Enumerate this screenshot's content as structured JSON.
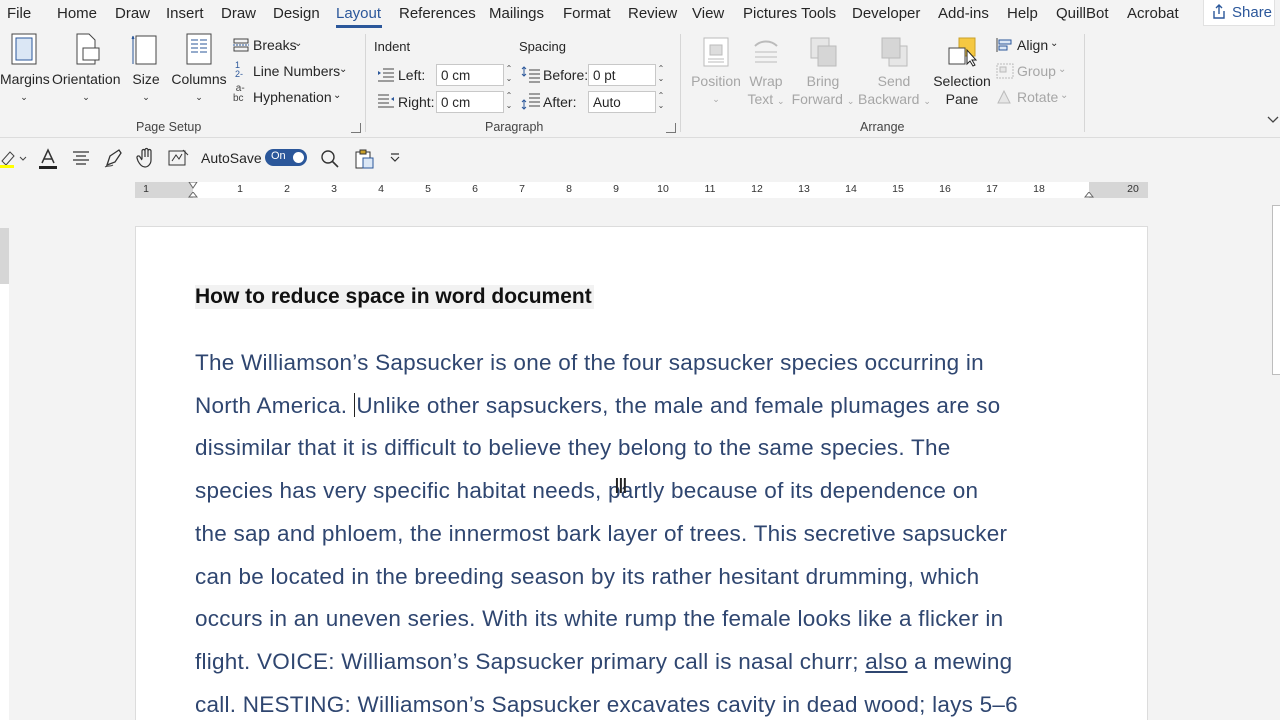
{
  "menu": {
    "tabs": [
      "File",
      "Home",
      "Draw",
      "Insert",
      "Draw",
      "Design",
      "Layout",
      "References",
      "Mailings",
      "Format",
      "Review",
      "View",
      "Pictures Tools",
      "Developer",
      "Add-ins",
      "Help",
      "QuillBot",
      "Acrobat"
    ],
    "active": "Layout",
    "share": "Share"
  },
  "ribbon": {
    "page_setup": {
      "margins": "Margins",
      "orientation": "Orientation",
      "size": "Size",
      "columns": "Columns",
      "breaks": "Breaks",
      "line_numbers": "Line Numbers",
      "hyphenation": "Hyphenation",
      "group_label": "Page Setup"
    },
    "paragraph": {
      "indent_header": "Indent",
      "spacing_header": "Spacing",
      "left_label": "Left:",
      "left_value": "0 cm",
      "right_label": "Right:",
      "right_value": "0 cm",
      "before_label": "Before:",
      "before_value": "0 pt",
      "after_label": "After:",
      "after_value": "Auto",
      "group_label": "Paragraph"
    },
    "arrange": {
      "position": "Position",
      "wrap_1": "Wrap",
      "wrap_2": "Text",
      "bring_1": "Bring",
      "bring_2": "Forward",
      "send_1": "Send",
      "send_2": "Backward",
      "selection_1": "Selection",
      "selection_2": "Pane",
      "align": "Align",
      "group": "Group",
      "rotate": "Rotate",
      "group_label": "Arrange"
    }
  },
  "qat": {
    "autosave_label": "AutoSave",
    "toggle_state": "On"
  },
  "ruler": {
    "numbers": [
      "1",
      "1",
      "2",
      "3",
      "4",
      "5",
      "6",
      "7",
      "8",
      "9",
      "10",
      "11",
      "12",
      "13",
      "14",
      "15",
      "16",
      "17",
      "18",
      "20"
    ]
  },
  "document": {
    "title": "How to reduce space in word document",
    "lines": [
      "The Williamson’s Sapsucker is one of the four sapsucker species occurring in",
      [
        "North America. ",
        "Unlike other sapsuckers, the male and female plumages are so"
      ],
      "dissimilar that it is difficult to believe they belong to the same species. The",
      "species has very specific habitat needs, partly because of its dependence on",
      "the sap and phloem, the innermost bark layer of trees. This secretive sapsucker",
      "can be located in the breeding season by its rather hesitant drumming, which",
      "occurs in an uneven series. With its white rump the female looks like a flicker in",
      [
        "flight. VOICE: Williamson’s Sapsucker primary call is nasal churr; ",
        "also",
        " a mewing"
      ],
      "call. NESTING: Williamson’s Sapsucker excavates cavity in dead wood; lays 5–6"
    ]
  },
  "colors": {
    "accent": "#2b579a",
    "body_text": "#2f4670",
    "ribbon_bg": "#f3f3f3"
  }
}
